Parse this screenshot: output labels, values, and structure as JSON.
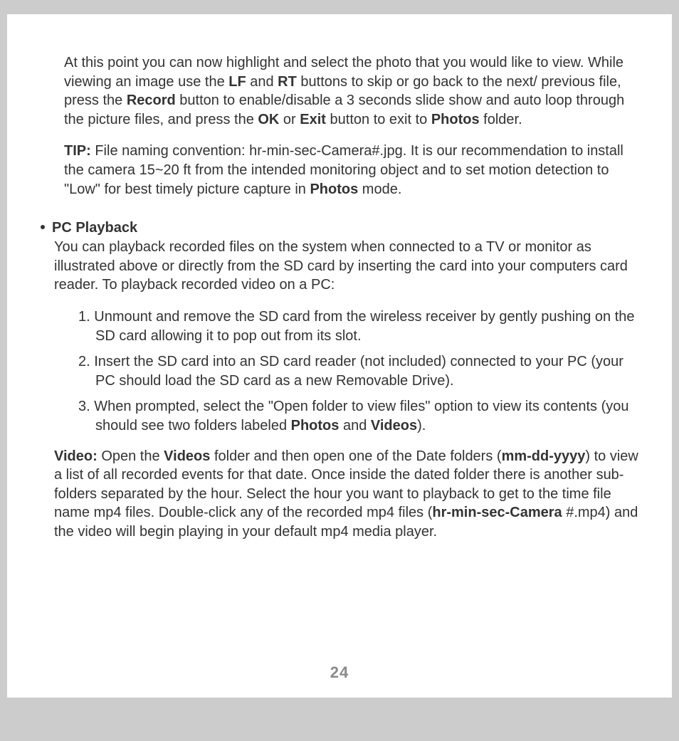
{
  "page_number": "24",
  "para1_pre": "At this point you can now highlight and select the photo that you would like to view. While viewing an image use the ",
  "para1_lf": "LF",
  "para1_mid1": " and ",
  "para1_rt": "RT",
  "para1_mid2": " buttons to skip or go back to the next/ previous file, press the ",
  "para1_record": "Record",
  "para1_mid3": " button to enable/disable a 3 seconds slide show and auto loop through the picture files, and press the ",
  "para1_ok": "OK",
  "para1_mid4": " or ",
  "para1_exit": "Exit",
  "para1_mid5": " button to exit to ",
  "para1_photos": "Photos",
  "para1_end": " folder.",
  "tip_label": "TIP:",
  "tip_mid": " File naming convention: hr-min-sec-Camera#.jpg. It is our recommendation to install the camera 15~20 ft from the intended monitoring object and to set motion detection to \"Low\" for best timely picture capture in ",
  "tip_photos": "Photos",
  "tip_end": " mode.",
  "pc_heading": "PC Playback",
  "pc_intro": "You can playback recorded files on the system when connected to a TV or monitor as illustrated above or directly from the SD card by inserting the card into your computers card reader. To playback recorded video on a PC:",
  "li1_num": "1. ",
  "li1": "Unmount and remove the SD card from the wireless receiver by gently pushing on the SD card allowing it to pop out from its slot.",
  "li2_num": "2. ",
  "li2": "Insert the SD card into an SD card reader (not included) connected to your PC (your PC should load the SD card as a new Removable Drive).",
  "li3_num": "3. ",
  "li3_pre": "When prompted, select the \"Open folder to view files\" option to view its contents (you should see two folders labeled ",
  "li3_photos": "Photos",
  "li3_mid": " and ",
  "li3_videos": "Videos",
  "li3_end": ").",
  "vid_label": "Video:",
  "vid_mid1": " Open the ",
  "vid_videos": "Videos",
  "vid_mid2": " folder and then open one of the Date folders (",
  "vid_dateformat": "mm-dd-yyyy",
  "vid_mid3": ") to view a list of all recorded events for that date. Once inside the dated folder there is another sub-folders separated by the hour. Select the hour you want to playback to get to the time file name mp4 files. Double-click any of the recorded mp4 files (",
  "vid_fileformat": "hr-min-sec-Camera",
  "vid_end": " #.mp4) and the video will begin playing in your default mp4 media player."
}
